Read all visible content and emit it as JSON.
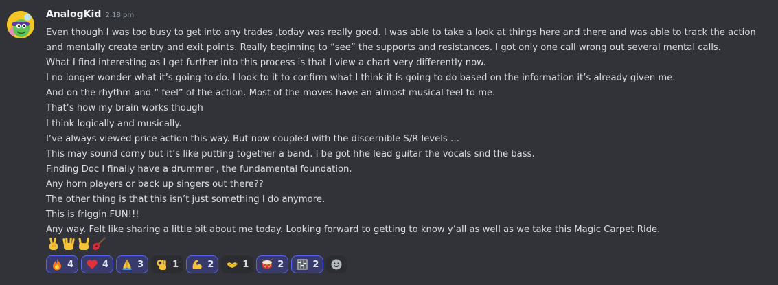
{
  "message": {
    "author": "AnalogKid",
    "timestamp": "2:18 pm",
    "lines": [
      "Even though I was too busy to get into any trades ,today was really good. I was able to take a look at things here and there and was able to track the action",
      "and mentally create entry and exit points. Really beginning to “see” the supports and resistances. I got only one call wrong out several mental calls.",
      "What I find interesting as I get further into this process is that I view a chart very differently now.",
      "I no longer wonder what it’s going to do. I look to it to confirm what I think it is going to do based on the information it’s already given me.",
      "And on the rhythm and “ feel” of the action.  Most of the moves have an almost musical feel to me.",
      "That’s how my brain works though",
      "I think logically and musically.",
      "I’ve always viewed price action this way. But now coupled with the discernible S/R levels …",
      "This may sound corny but it’s like putting together a band. I be got hhe lead guitar the vocals snd the bass.",
      "Finding Doc I finally have a drummer , the  fundamental foundation.",
      "Any horn players or back up singers out there??",
      "The other thing is that this isn’t just something I do anymore.",
      "This is friggin FUN!!!",
      "Any way. Felt like sharing a little bit about me today. Looking forward to getting to know y’all as well as we take this Magic Carpet Ride."
    ],
    "trailing_emojis": [
      "victory-hand-icon",
      "vulcan-salute-icon",
      "sign-of-horns-icon",
      "guitar-icon"
    ]
  },
  "reactions": [
    {
      "icon": "fire-icon",
      "count": "4",
      "me": true
    },
    {
      "icon": "red-heart-icon",
      "count": "4",
      "me": true
    },
    {
      "icon": "folded-hands-icon",
      "count": "3",
      "me": true
    },
    {
      "icon": "ok-hand-icon",
      "count": "1",
      "me": false
    },
    {
      "icon": "flexed-biceps-icon",
      "count": "2",
      "me": true
    },
    {
      "icon": "handshake-icon",
      "count": "1",
      "me": false
    },
    {
      "icon": "drum-icon",
      "count": "2",
      "me": true
    },
    {
      "icon": "level-slider-icon",
      "count": "2",
      "me": true
    }
  ],
  "colors": {
    "background": "#323339",
    "text": "#dbdee1",
    "username": "#f2f3f5",
    "timestamp": "#949ba4",
    "reaction_me_bg": "#373a6b",
    "reaction_me_border": "#5865f2",
    "reaction_bg": "#2b2d31"
  }
}
